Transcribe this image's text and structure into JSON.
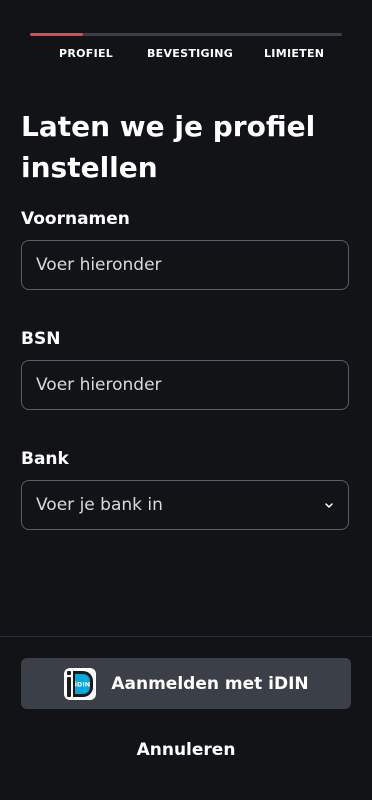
{
  "stepper": {
    "steps": [
      {
        "label": "PROFIEL",
        "active": true
      },
      {
        "label": "BEVESTIGING",
        "active": false
      },
      {
        "label": "LIMIETEN",
        "active": false
      }
    ],
    "progress_fraction": 0.17,
    "progress_color": "#e5484d",
    "track_color": "#3a3e46"
  },
  "page": {
    "title_line1": "Laten we je profiel",
    "title_line2": "instellen"
  },
  "form": {
    "first_names": {
      "label": "Voornamen",
      "placeholder": "Voer hieronder",
      "value": ""
    },
    "bsn": {
      "label": "BSN",
      "placeholder": "Voer hieronder",
      "value": ""
    },
    "bank": {
      "label": "Bank",
      "placeholder": "Voer je bank in",
      "icon": "chevron-down-icon"
    }
  },
  "actions": {
    "idin_label": "Aanmelden met iDIN",
    "idin_logo_text": "iDIN",
    "idin_icon": "idin-logo-icon",
    "cancel_label": "Annuleren"
  },
  "colors": {
    "background": "#111317",
    "button_bg": "#3b4048",
    "accent": "#e5484d",
    "idin_blue": "#00a9e0"
  }
}
